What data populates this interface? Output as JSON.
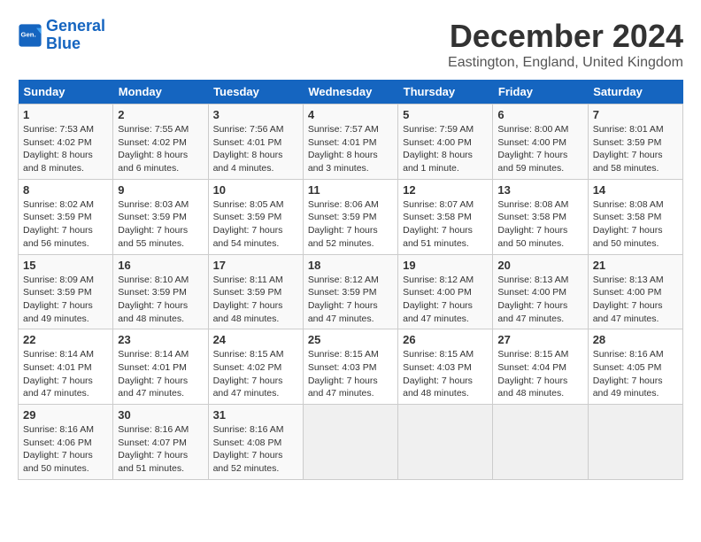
{
  "logo": {
    "line1": "General",
    "line2": "Blue"
  },
  "title": "December 2024",
  "subtitle": "Eastington, England, United Kingdom",
  "weekdays": [
    "Sunday",
    "Monday",
    "Tuesday",
    "Wednesday",
    "Thursday",
    "Friday",
    "Saturday"
  ],
  "weeks": [
    [
      {
        "day": "1",
        "sunrise": "7:53 AM",
        "sunset": "4:02 PM",
        "daylight": "8 hours and 8 minutes."
      },
      {
        "day": "2",
        "sunrise": "7:55 AM",
        "sunset": "4:02 PM",
        "daylight": "8 hours and 6 minutes."
      },
      {
        "day": "3",
        "sunrise": "7:56 AM",
        "sunset": "4:01 PM",
        "daylight": "8 hours and 4 minutes."
      },
      {
        "day": "4",
        "sunrise": "7:57 AM",
        "sunset": "4:01 PM",
        "daylight": "8 hours and 3 minutes."
      },
      {
        "day": "5",
        "sunrise": "7:59 AM",
        "sunset": "4:00 PM",
        "daylight": "8 hours and 1 minute."
      },
      {
        "day": "6",
        "sunrise": "8:00 AM",
        "sunset": "4:00 PM",
        "daylight": "7 hours and 59 minutes."
      },
      {
        "day": "7",
        "sunrise": "8:01 AM",
        "sunset": "3:59 PM",
        "daylight": "7 hours and 58 minutes."
      }
    ],
    [
      {
        "day": "8",
        "sunrise": "8:02 AM",
        "sunset": "3:59 PM",
        "daylight": "7 hours and 56 minutes."
      },
      {
        "day": "9",
        "sunrise": "8:03 AM",
        "sunset": "3:59 PM",
        "daylight": "7 hours and 55 minutes."
      },
      {
        "day": "10",
        "sunrise": "8:05 AM",
        "sunset": "3:59 PM",
        "daylight": "7 hours and 54 minutes."
      },
      {
        "day": "11",
        "sunrise": "8:06 AM",
        "sunset": "3:59 PM",
        "daylight": "7 hours and 52 minutes."
      },
      {
        "day": "12",
        "sunrise": "8:07 AM",
        "sunset": "3:58 PM",
        "daylight": "7 hours and 51 minutes."
      },
      {
        "day": "13",
        "sunrise": "8:08 AM",
        "sunset": "3:58 PM",
        "daylight": "7 hours and 50 minutes."
      },
      {
        "day": "14",
        "sunrise": "8:08 AM",
        "sunset": "3:58 PM",
        "daylight": "7 hours and 50 minutes."
      }
    ],
    [
      {
        "day": "15",
        "sunrise": "8:09 AM",
        "sunset": "3:59 PM",
        "daylight": "7 hours and 49 minutes."
      },
      {
        "day": "16",
        "sunrise": "8:10 AM",
        "sunset": "3:59 PM",
        "daylight": "7 hours and 48 minutes."
      },
      {
        "day": "17",
        "sunrise": "8:11 AM",
        "sunset": "3:59 PM",
        "daylight": "7 hours and 48 minutes."
      },
      {
        "day": "18",
        "sunrise": "8:12 AM",
        "sunset": "3:59 PM",
        "daylight": "7 hours and 47 minutes."
      },
      {
        "day": "19",
        "sunrise": "8:12 AM",
        "sunset": "4:00 PM",
        "daylight": "7 hours and 47 minutes."
      },
      {
        "day": "20",
        "sunrise": "8:13 AM",
        "sunset": "4:00 PM",
        "daylight": "7 hours and 47 minutes."
      },
      {
        "day": "21",
        "sunrise": "8:13 AM",
        "sunset": "4:00 PM",
        "daylight": "7 hours and 47 minutes."
      }
    ],
    [
      {
        "day": "22",
        "sunrise": "8:14 AM",
        "sunset": "4:01 PM",
        "daylight": "7 hours and 47 minutes."
      },
      {
        "day": "23",
        "sunrise": "8:14 AM",
        "sunset": "4:01 PM",
        "daylight": "7 hours and 47 minutes."
      },
      {
        "day": "24",
        "sunrise": "8:15 AM",
        "sunset": "4:02 PM",
        "daylight": "7 hours and 47 minutes."
      },
      {
        "day": "25",
        "sunrise": "8:15 AM",
        "sunset": "4:03 PM",
        "daylight": "7 hours and 47 minutes."
      },
      {
        "day": "26",
        "sunrise": "8:15 AM",
        "sunset": "4:03 PM",
        "daylight": "7 hours and 48 minutes."
      },
      {
        "day": "27",
        "sunrise": "8:15 AM",
        "sunset": "4:04 PM",
        "daylight": "7 hours and 48 minutes."
      },
      {
        "day": "28",
        "sunrise": "8:16 AM",
        "sunset": "4:05 PM",
        "daylight": "7 hours and 49 minutes."
      }
    ],
    [
      {
        "day": "29",
        "sunrise": "8:16 AM",
        "sunset": "4:06 PM",
        "daylight": "7 hours and 50 minutes."
      },
      {
        "day": "30",
        "sunrise": "8:16 AM",
        "sunset": "4:07 PM",
        "daylight": "7 hours and 51 minutes."
      },
      {
        "day": "31",
        "sunrise": "8:16 AM",
        "sunset": "4:08 PM",
        "daylight": "7 hours and 52 minutes."
      },
      null,
      null,
      null,
      null
    ]
  ]
}
